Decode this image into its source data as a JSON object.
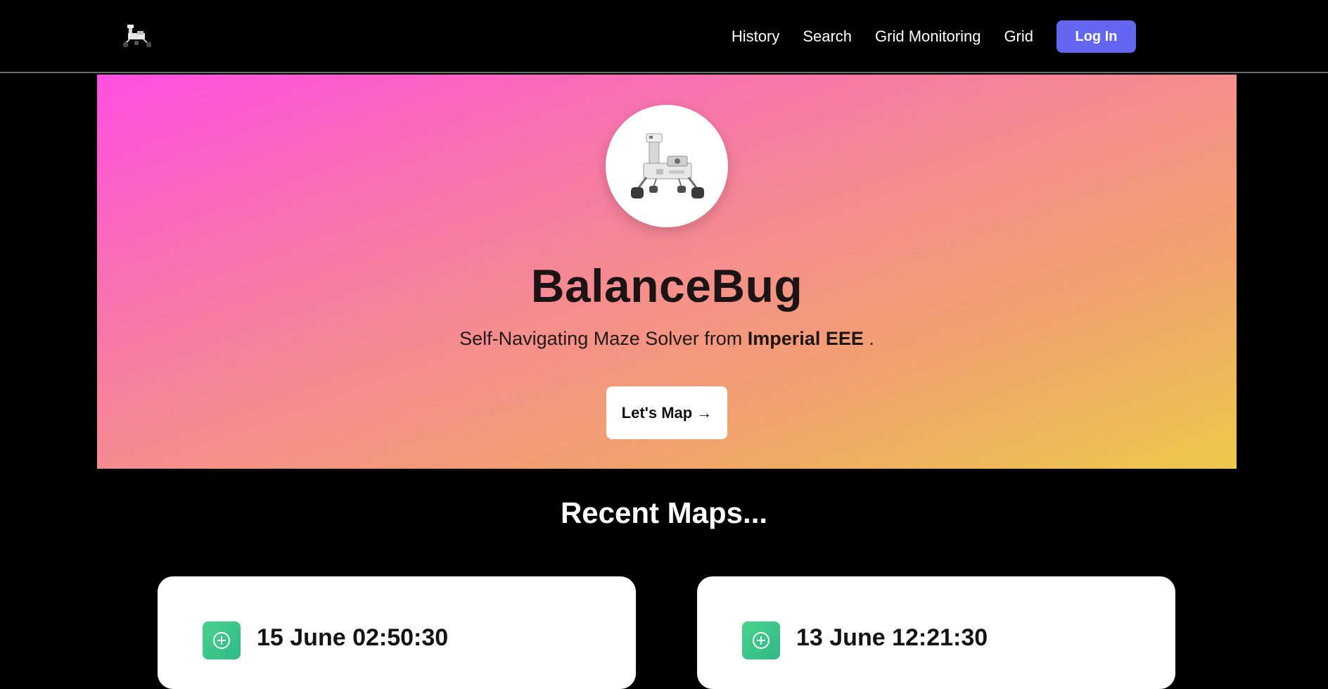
{
  "nav": {
    "logo_icon": "rover-logo-icon",
    "links": [
      "History",
      "Search",
      "Grid Monitoring",
      "Grid"
    ],
    "login_label": "Log In",
    "login_color": "#6466f1"
  },
  "hero": {
    "avatar_icon": "rover-icon",
    "title": "BalanceBug",
    "subtitle_prefix": "Self-Navigating Maze Solver from ",
    "subtitle_strong": "Imperial EEE",
    "subtitle_suffix": " .",
    "cta_label": "Let's Map →",
    "gradient_start": "#ff4fe2",
    "gradient_end": "#ecc94b"
  },
  "recent": {
    "title": "Recent Maps...",
    "cards": [
      {
        "icon": "add-circle-icon",
        "title": "15 June 02:50:30"
      },
      {
        "icon": "add-circle-icon",
        "title": "13 June 12:21:30"
      }
    ]
  }
}
